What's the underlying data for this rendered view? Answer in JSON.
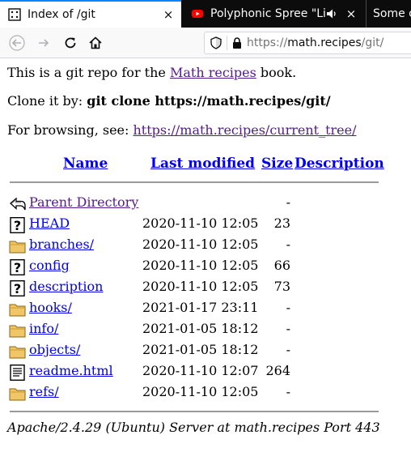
{
  "browser": {
    "tabs": [
      {
        "title": "Index of /git",
        "active": true,
        "favicon": "page-favicon-icon"
      },
      {
        "title": "Polyphonic Spree \"Lit",
        "active": false,
        "favicon": "youtube-icon",
        "audio": "speaker-icon"
      },
      {
        "title": "Some c",
        "active": false
      }
    ],
    "close_glyph": "×",
    "url": {
      "scheme": "https://",
      "host": "math.recipes",
      "path": "/git/"
    }
  },
  "page": {
    "intro": {
      "prefix": "This is a git repo for the ",
      "link": "Math recipes",
      "suffix": " book."
    },
    "clone": {
      "prefix": "Clone it by: ",
      "command": "git clone https://math.recipes/git/"
    },
    "browse": {
      "prefix": "For browsing, see: ",
      "link": "https://math.recipes/current_tree/"
    },
    "columns": {
      "name": "Name",
      "modified": "Last modified",
      "size": "Size",
      "description": "Description"
    },
    "entries": [
      {
        "name": "Parent Directory",
        "modified": "",
        "size": "-",
        "icon": "back-icon"
      },
      {
        "name": "HEAD",
        "modified": "2020-11-10 12:05",
        "size": "23",
        "icon": "unknown-file-icon"
      },
      {
        "name": "branches/",
        "modified": "2020-11-10 12:05",
        "size": "-",
        "icon": "folder-icon"
      },
      {
        "name": "config",
        "modified": "2020-11-10 12:05",
        "size": "66",
        "icon": "unknown-file-icon"
      },
      {
        "name": "description",
        "modified": "2020-11-10 12:05",
        "size": "73",
        "icon": "unknown-file-icon"
      },
      {
        "name": "hooks/",
        "modified": "2021-01-17 23:11",
        "size": "-",
        "icon": "folder-icon"
      },
      {
        "name": "info/",
        "modified": "2021-01-05 18:12",
        "size": "-",
        "icon": "folder-icon"
      },
      {
        "name": "objects/",
        "modified": "2021-01-05 18:12",
        "size": "-",
        "icon": "folder-icon"
      },
      {
        "name": "readme.html",
        "modified": "2020-11-10 12:07",
        "size": "264",
        "icon": "text-file-icon"
      },
      {
        "name": "refs/",
        "modified": "2020-11-10 12:05",
        "size": "-",
        "icon": "folder-icon"
      }
    ],
    "footer": "Apache/2.4.29 (Ubuntu) Server at math.recipes Port 443"
  }
}
